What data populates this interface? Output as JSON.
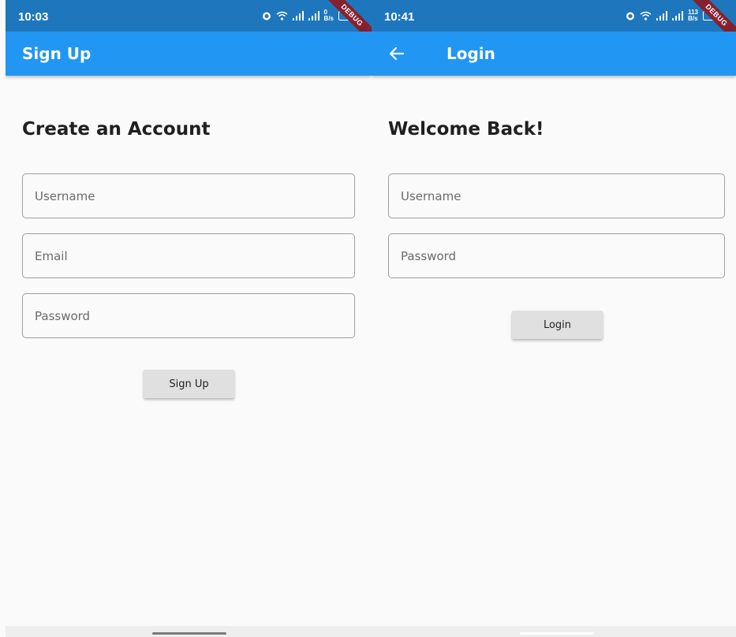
{
  "left_screen": {
    "status_bar": {
      "time": "10:03",
      "speed_top": "0",
      "speed_bottom": "B/s",
      "battery": "61",
      "debug_label": "DEBUG"
    },
    "app_bar": {
      "title": "Sign Up"
    },
    "heading": "Create an Account",
    "fields": {
      "username_placeholder": "Username",
      "email_placeholder": "Email",
      "password_placeholder": "Password"
    },
    "button_label": "Sign Up"
  },
  "right_screen": {
    "status_bar": {
      "time": "10:41",
      "speed_top": "113",
      "speed_bottom": "B/s",
      "battery": "65",
      "debug_label": "DEBUG"
    },
    "app_bar": {
      "title": "Login",
      "back_icon": "arrow-back-icon"
    },
    "heading": "Welcome Back!",
    "fields": {
      "username_placeholder": "Username",
      "password_placeholder": "Password"
    },
    "button_label": "Login"
  },
  "colors": {
    "status_bar": "#1e77bd",
    "app_bar": "#2196f3",
    "background": "#fafafa",
    "button": "#e0e0e0",
    "debug_banner": "#8b1d28"
  }
}
